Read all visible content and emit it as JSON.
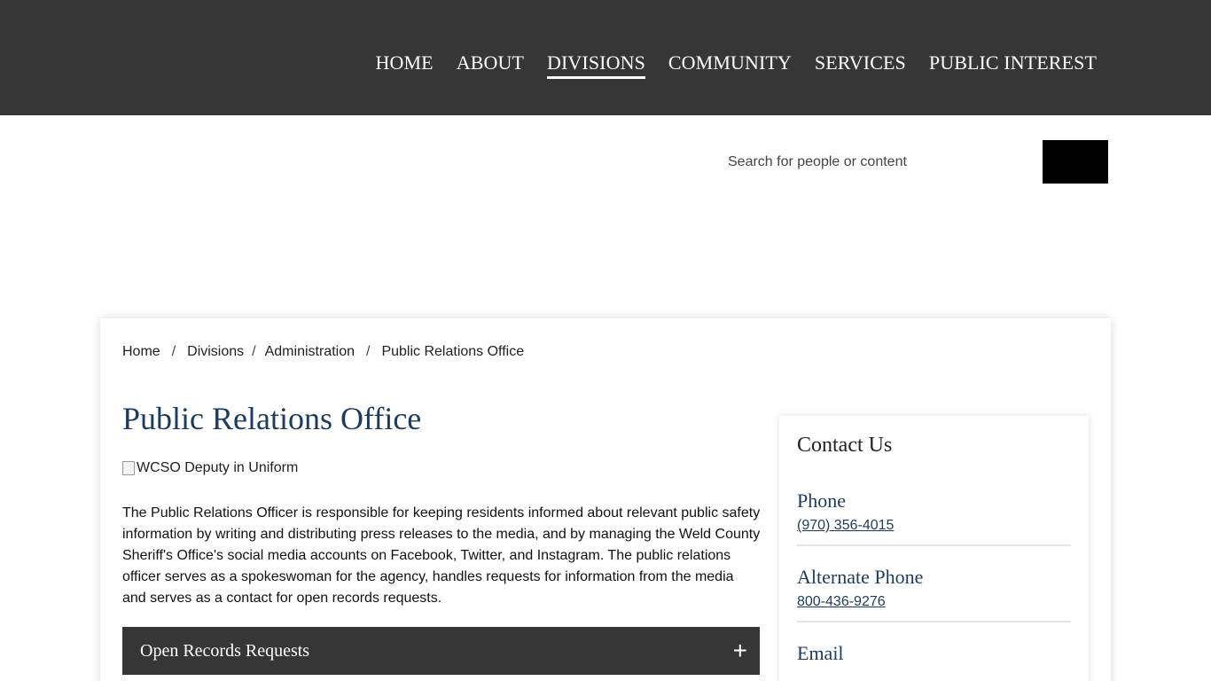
{
  "nav": {
    "items": [
      {
        "label": "HOME"
      },
      {
        "label": "ABOUT"
      },
      {
        "label": "DIVISIONS",
        "active": true
      },
      {
        "label": "COMMUNITY"
      },
      {
        "label": "SERVICES"
      },
      {
        "label": "PUBLIC INTEREST"
      }
    ]
  },
  "search": {
    "placeholder": "Search for people or content",
    "value": ""
  },
  "breadcrumb": {
    "items": [
      "Home",
      "Divisions",
      "Administration",
      "Public Relations Office"
    ],
    "separator": "/"
  },
  "main": {
    "title": "Public Relations Office",
    "image_alt": "WCSO Deputy in Uniform",
    "body": "The Public Relations Officer is responsible for keeping residents informed about relevant public safety information by writing and distributing press releases to the media, and by managing the Weld County Sheriff's Office's social media accounts on Facebook, Twitter, and Instagram. The public relations officer serves as a spokeswoman for the agency, handles requests for information from the media and serves as a contact for open records requests.",
    "accordion": {
      "title": "Open Records Requests",
      "icon": "+"
    }
  },
  "contact": {
    "title": "Contact Us",
    "items": [
      {
        "label": "Phone",
        "value": "(970) 356-4015"
      },
      {
        "label": "Alternate Phone",
        "value": "800-436-9276"
      }
    ],
    "email_label": "Email"
  },
  "colors": {
    "header_bg": "#363636",
    "heading_blue": "#1d3b5a",
    "search_button": "#000000"
  }
}
